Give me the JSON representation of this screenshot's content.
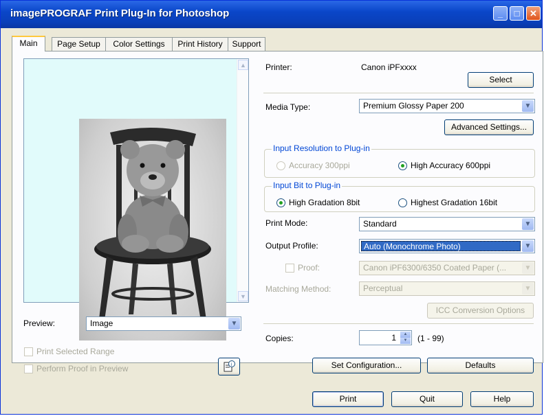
{
  "window": {
    "title": "imagePROGRAF Print Plug-In for Photoshop"
  },
  "tabs": [
    {
      "label": "Main"
    },
    {
      "label": "Page Setup"
    },
    {
      "label": "Color Settings"
    },
    {
      "label": "Print History"
    },
    {
      "label": "Support"
    }
  ],
  "printer": {
    "label": "Printer:",
    "value": "Canon iPFxxxx",
    "select_button": "Select"
  },
  "media_type": {
    "label": "Media Type:",
    "value": "Premium Glossy Paper 200",
    "advanced_button": "Advanced Settings..."
  },
  "input_resolution": {
    "title": "Input Resolution to Plug-in",
    "option1": "Accuracy 300ppi",
    "option2": "High Accuracy 600ppi",
    "selected": "High Accuracy 600ppi"
  },
  "input_bit": {
    "title": "Input Bit to Plug-in",
    "option1": "High Gradation 8bit",
    "option2": "Highest Gradation 16bit",
    "selected": "High Gradation 8bit"
  },
  "print_mode": {
    "label": "Print Mode:",
    "value": "Standard"
  },
  "output_profile": {
    "label": "Output Profile:",
    "value": "Auto (Monochrome Photo)"
  },
  "proof": {
    "label": "Proof:",
    "value": "Canon iPF6300/6350 Coated Paper (...",
    "checked": false
  },
  "matching_method": {
    "label": "Matching Method:",
    "value": "Perceptual"
  },
  "icc_button": "ICC Conversion Options",
  "copies": {
    "label": "Copies:",
    "value": "1",
    "range": "(1 - 99)"
  },
  "set_configuration_button": "Set Configuration...",
  "defaults_button": "Defaults",
  "preview": {
    "label": "Preview:",
    "value": "Image"
  },
  "print_selected_range": "Print Selected Range",
  "perform_proof_in_preview": "Perform Proof in Preview",
  "bottom": {
    "print": "Print",
    "quit": "Quit",
    "help": "Help"
  },
  "colors": {
    "title_bar": "#0a46c9",
    "group_title": "#0046d5",
    "selection": "#316ac5",
    "preview_bg": "#e1fbfb"
  }
}
